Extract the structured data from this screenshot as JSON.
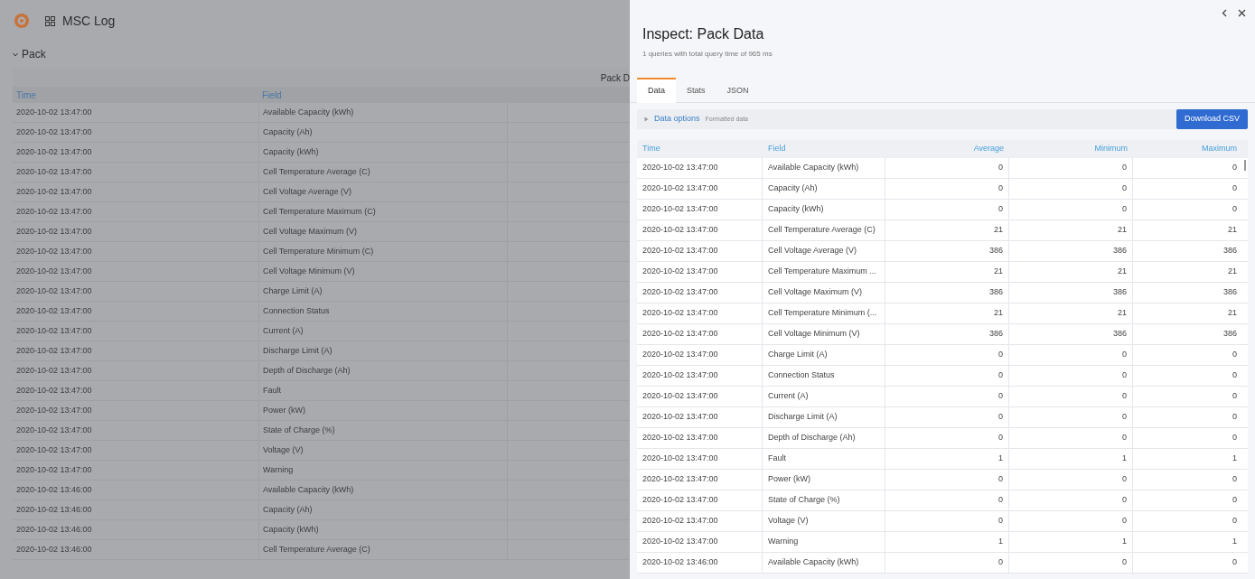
{
  "dashboard": {
    "title": "MSC Log",
    "row_title": "Pack",
    "panel_title": "Pack D",
    "table": {
      "columns": [
        "Time",
        "Field"
      ],
      "rows": [
        [
          "2020-10-02 13:47:00",
          "Available Capacity (kWh)"
        ],
        [
          "2020-10-02 13:47:00",
          "Capacity (Ah)"
        ],
        [
          "2020-10-02 13:47:00",
          "Capacity (kWh)"
        ],
        [
          "2020-10-02 13:47:00",
          "Cell Temperature Average (C)"
        ],
        [
          "2020-10-02 13:47:00",
          "Cell Voltage Average (V)"
        ],
        [
          "2020-10-02 13:47:00",
          "Cell Temperature Maximum (C)"
        ],
        [
          "2020-10-02 13:47:00",
          "Cell Voltage Maximum (V)"
        ],
        [
          "2020-10-02 13:47:00",
          "Cell Temperature Minimum (C)"
        ],
        [
          "2020-10-02 13:47:00",
          "Cell Voltage Minimum (V)"
        ],
        [
          "2020-10-02 13:47:00",
          "Charge Limit (A)"
        ],
        [
          "2020-10-02 13:47:00",
          "Connection Status"
        ],
        [
          "2020-10-02 13:47:00",
          "Current (A)"
        ],
        [
          "2020-10-02 13:47:00",
          "Discharge Limit (A)"
        ],
        [
          "2020-10-02 13:47:00",
          "Depth of Discharge (Ah)"
        ],
        [
          "2020-10-02 13:47:00",
          "Fault"
        ],
        [
          "2020-10-02 13:47:00",
          "Power (kW)"
        ],
        [
          "2020-10-02 13:47:00",
          "State of Charge (%)"
        ],
        [
          "2020-10-02 13:47:00",
          "Voltage (V)"
        ],
        [
          "2020-10-02 13:47:00",
          "Warning"
        ],
        [
          "2020-10-02 13:46:00",
          "Available Capacity (kWh)"
        ],
        [
          "2020-10-02 13:46:00",
          "Capacity (Ah)"
        ],
        [
          "2020-10-02 13:46:00",
          "Capacity (kWh)"
        ],
        [
          "2020-10-02 13:46:00",
          "Cell Temperature Average (C)"
        ]
      ]
    }
  },
  "inspect": {
    "title": "Inspect: Pack Data",
    "subtitle": "1 queries with total query time of 965 ms",
    "tabs": [
      {
        "label": "Data",
        "selected": true
      },
      {
        "label": "Stats",
        "selected": false
      },
      {
        "label": "JSON",
        "selected": false
      }
    ],
    "data_options": {
      "label": "Data options",
      "summary": "Formatted data",
      "expanded": false
    },
    "download_button": "Download CSV",
    "table": {
      "columns": [
        "Time",
        "Field",
        "Average",
        "Minimum",
        "Maximum"
      ],
      "rows": [
        [
          "2020-10-02 13:47:00",
          "Available Capacity (kWh)",
          "0",
          "0",
          "0"
        ],
        [
          "2020-10-02 13:47:00",
          "Capacity (Ah)",
          "0",
          "0",
          "0"
        ],
        [
          "2020-10-02 13:47:00",
          "Capacity (kWh)",
          "0",
          "0",
          "0"
        ],
        [
          "2020-10-02 13:47:00",
          "Cell Temperature Average (C)",
          "21",
          "21",
          "21"
        ],
        [
          "2020-10-02 13:47:00",
          "Cell Voltage Average (V)",
          "386",
          "386",
          "386"
        ],
        [
          "2020-10-02 13:47:00",
          "Cell Temperature Maximum ...",
          "21",
          "21",
          "21"
        ],
        [
          "2020-10-02 13:47:00",
          "Cell Voltage Maximum (V)",
          "386",
          "386",
          "386"
        ],
        [
          "2020-10-02 13:47:00",
          "Cell Temperature Minimum (...",
          "21",
          "21",
          "21"
        ],
        [
          "2020-10-02 13:47:00",
          "Cell Voltage Minimum (V)",
          "386",
          "386",
          "386"
        ],
        [
          "2020-10-02 13:47:00",
          "Charge Limit (A)",
          "0",
          "0",
          "0"
        ],
        [
          "2020-10-02 13:47:00",
          "Connection Status",
          "0",
          "0",
          "0"
        ],
        [
          "2020-10-02 13:47:00",
          "Current (A)",
          "0",
          "0",
          "0"
        ],
        [
          "2020-10-02 13:47:00",
          "Discharge Limit (A)",
          "0",
          "0",
          "0"
        ],
        [
          "2020-10-02 13:47:00",
          "Depth of Discharge (Ah)",
          "0",
          "0",
          "0"
        ],
        [
          "2020-10-02 13:47:00",
          "Fault",
          "1",
          "1",
          "1"
        ],
        [
          "2020-10-02 13:47:00",
          "Power (kW)",
          "0",
          "0",
          "0"
        ],
        [
          "2020-10-02 13:47:00",
          "State of Charge (%)",
          "0",
          "0",
          "0"
        ],
        [
          "2020-10-02 13:47:00",
          "Voltage (V)",
          "0",
          "0",
          "0"
        ],
        [
          "2020-10-02 13:47:00",
          "Warning",
          "1",
          "1",
          "1"
        ],
        [
          "2020-10-02 13:46:00",
          "Available Capacity (kWh)",
          "0",
          "0",
          "0"
        ]
      ]
    }
  }
}
